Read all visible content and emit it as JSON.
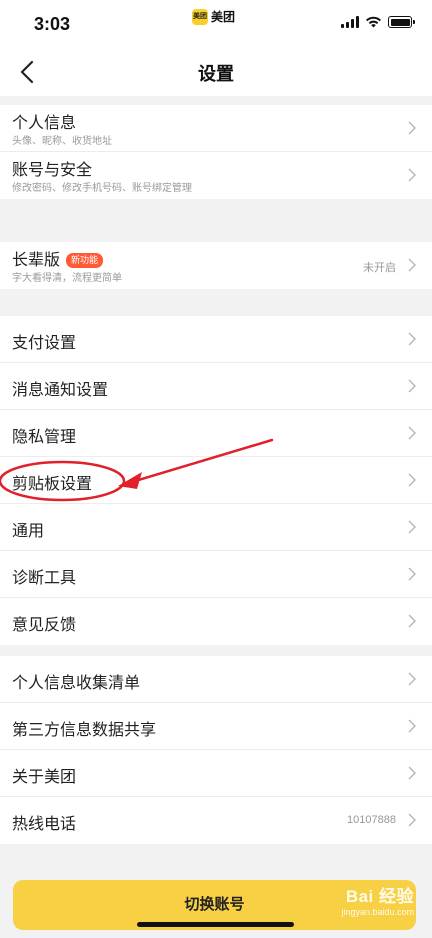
{
  "status_bar": {
    "time": "3:03",
    "app_logo_text": "美团",
    "app_name": "美团"
  },
  "header": {
    "title": "设置"
  },
  "groups": [
    [
      {
        "label": "个人信息",
        "sub": "头像、昵称、收货地址"
      },
      {
        "label": "账号与安全",
        "sub": "修改密码、修改手机号码、账号绑定管理"
      }
    ],
    [
      {
        "label": "长辈版",
        "badge": "新功能",
        "sub": "字大看得清，流程更简单",
        "value": "未开启"
      }
    ],
    [
      {
        "label": "支付设置"
      },
      {
        "label": "消息通知设置"
      },
      {
        "label": "隐私管理"
      },
      {
        "label": "剪贴板设置"
      },
      {
        "label": "通用"
      },
      {
        "label": "诊断工具"
      },
      {
        "label": "意见反馈"
      }
    ],
    [
      {
        "label": "个人信息收集清单"
      },
      {
        "label": "第三方信息数据共享"
      },
      {
        "label": "关于美团"
      },
      {
        "label": "热线电话",
        "value": "10107888"
      }
    ]
  ],
  "footer": {
    "switch_account_label": "切换账号"
  },
  "watermark": {
    "main": "Bai 经验",
    "sub": "jingyan.baidu.com"
  },
  "colors": {
    "accent": "#f8d044",
    "badge": "#ff5b39",
    "annotation": "#e0202a"
  }
}
